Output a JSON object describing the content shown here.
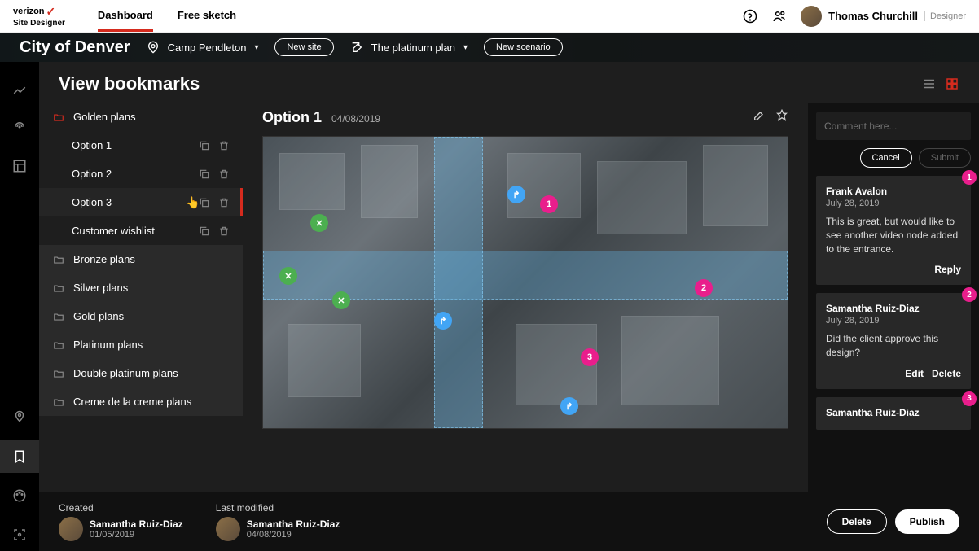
{
  "brand": {
    "name": "verizon",
    "product": "Site Designer"
  },
  "topnav": {
    "dashboard": "Dashboard",
    "freesketch": "Free sketch"
  },
  "user": {
    "name": "Thomas Churchill",
    "role": "Designer"
  },
  "header": {
    "city": "City of Denver",
    "site": "Camp Pendleton",
    "new_site": "New site",
    "plan": "The platinum plan",
    "new_scenario": "New scenario"
  },
  "page": {
    "title": "View bookmarks"
  },
  "tree": {
    "active_folder": "Golden plans",
    "children": [
      "Option 1",
      "Option 2",
      "Option 3",
      "Customer wishlist"
    ],
    "folders": [
      "Bronze plans",
      "Silver plans",
      "Gold plans",
      "Platinum plans",
      "Double platinum plans",
      "Creme de la creme plans"
    ]
  },
  "preview": {
    "title": "Option 1",
    "date": "04/08/2019"
  },
  "comments": {
    "placeholder": "Comment here...",
    "cancel": "Cancel",
    "submit": "Submit",
    "items": [
      {
        "author": "Frank Avalon",
        "date": "July 28, 2019",
        "text": "This is great, but would like to see another video node added to the entrance.",
        "actions": [
          "Reply"
        ]
      },
      {
        "author": "Samantha Ruiz-Diaz",
        "date": "July 28, 2019",
        "text": "Did the client approve this design?",
        "actions": [
          "Edit",
          "Delete"
        ]
      },
      {
        "author": "Samantha Ruiz-Diaz",
        "date": "",
        "text": "",
        "actions": []
      }
    ]
  },
  "footer": {
    "created_label": "Created",
    "modified_label": "Last modified",
    "created_by": "Samantha Ruiz-Diaz",
    "created_date": "01/05/2019",
    "modified_by": "Samantha Ruiz-Diaz",
    "modified_date": "04/08/2019",
    "delete": "Delete",
    "publish": "Publish"
  }
}
